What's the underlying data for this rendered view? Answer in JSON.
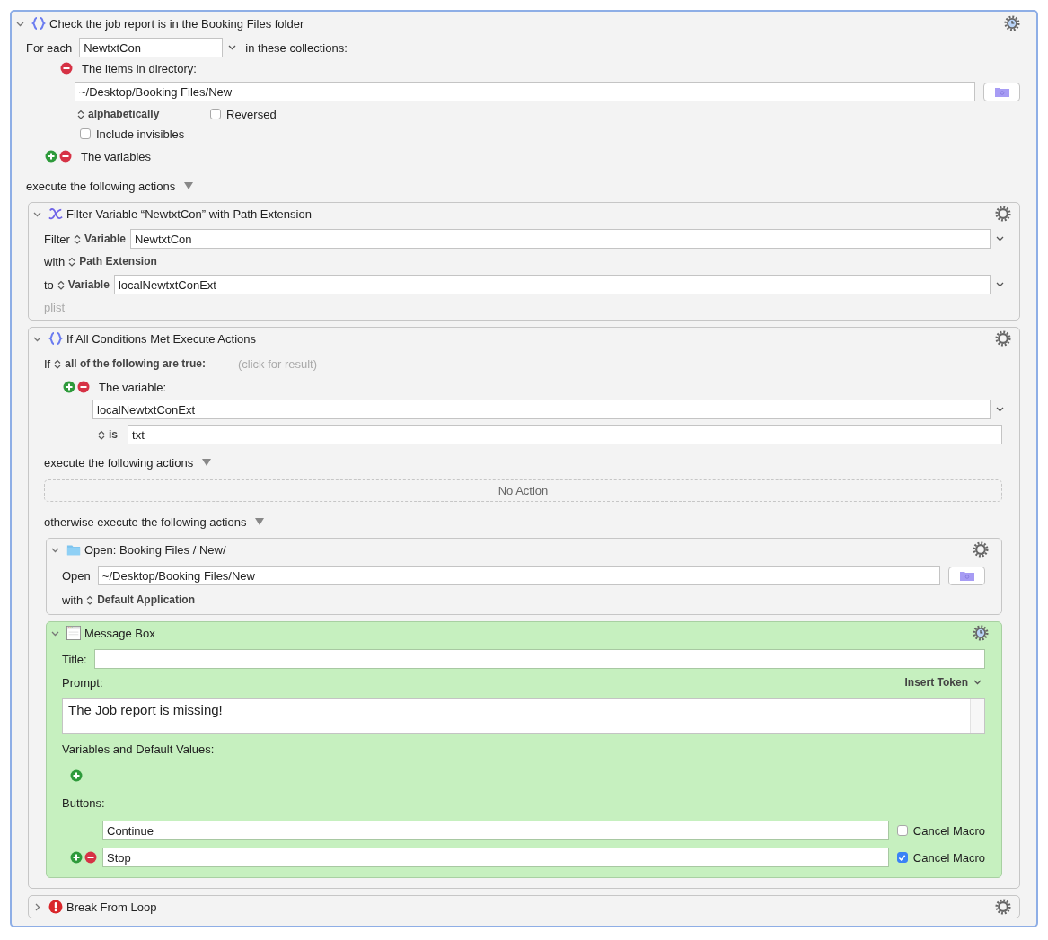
{
  "macro": {
    "kind": "for_each",
    "title": "Check the job report is in the Booking Files folder",
    "expanded": true,
    "timed": true,
    "for_each_label": "For each",
    "variable": "NewtxtCon",
    "collections_label": "in these collections:",
    "directory": {
      "label": "The items in directory:",
      "path": "~/Desktop/Booking Files/New",
      "sort": "alphabetically",
      "reversed_label": "Reversed",
      "reversed": false,
      "invisibles_label": "Include invisibles",
      "invisibles": false
    },
    "variables_label": "The variables",
    "execute_label": "execute the following actions",
    "actions": [
      {
        "kind": "filter",
        "title": "Filter Variable “NewtxtCon” with Path Extension",
        "expanded": true,
        "selected": false,
        "timed": false,
        "filter_label": "Filter",
        "source_type": "Variable",
        "source": "NewtxtCon",
        "with_label": "with",
        "operation": "Path Extension",
        "to_label": "to",
        "target_type": "Variable",
        "target": "localNewtxtConExt",
        "hint": "plist"
      },
      {
        "kind": "if",
        "title": "If All Conditions Met Execute Actions",
        "expanded": true,
        "selected": false,
        "timed": false,
        "if_label": "If",
        "match": "all of the following are true:",
        "result_hint": "(click for result)",
        "condition": {
          "label": "The variable:",
          "variable": "localNewtxtConExt",
          "operator": "is",
          "value": "txt"
        },
        "then_label": "execute the following actions",
        "then_empty": "No Action",
        "else_label": "otherwise execute the following actions",
        "else_actions": [
          {
            "kind": "open",
            "title": "Open: Booking Files / New/",
            "expanded": true,
            "selected": false,
            "timed": false,
            "open_label": "Open",
            "path": "~/Desktop/Booking Files/New",
            "with_label": "with",
            "application": "Default Application"
          },
          {
            "kind": "message",
            "title": "Message Box",
            "expanded": true,
            "selected": true,
            "timed": true,
            "title_label": "Title:",
            "prompt_label": "Prompt:",
            "insert_token": "Insert Token",
            "prompt": "The Job report is missing!",
            "variables_label": "Variables and Default Values:",
            "buttons_label": "Buttons:",
            "buttons": [
              {
                "label": "Continue",
                "cancel_label": "Cancel Macro",
                "cancel": false
              },
              {
                "label": "Stop",
                "cancel_label": "Cancel Macro",
                "cancel": true
              }
            ]
          }
        ]
      },
      {
        "kind": "break",
        "title": "Break From Loop",
        "expanded": false,
        "selected": false,
        "timed": false
      }
    ]
  }
}
